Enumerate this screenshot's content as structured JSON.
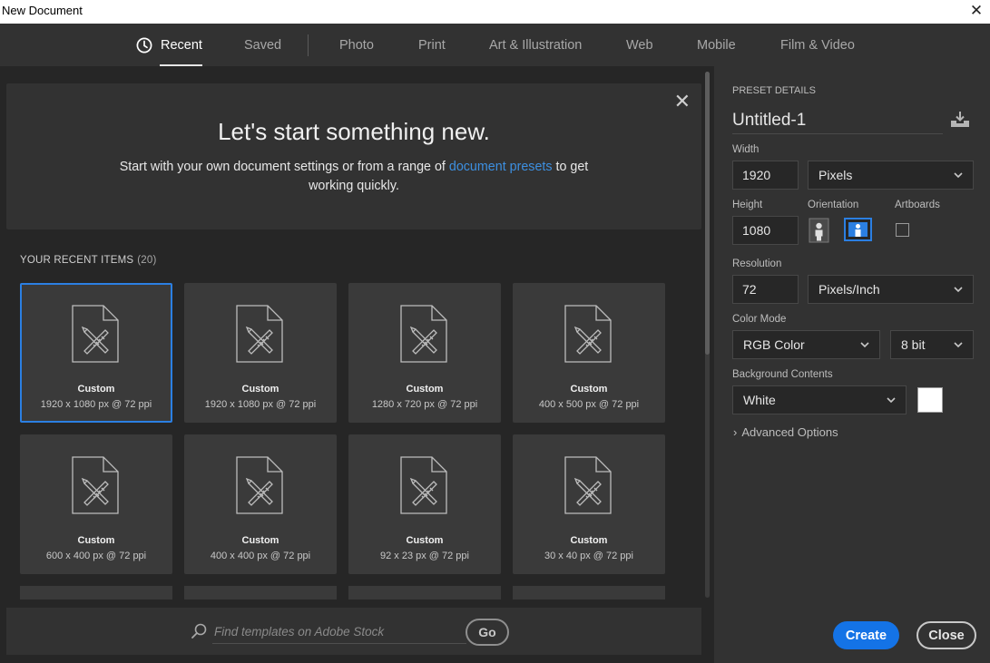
{
  "window": {
    "title": "New Document",
    "close_glyph": "✕"
  },
  "tabs": [
    {
      "label": "Recent",
      "active": true,
      "icon": "clock-icon"
    },
    {
      "label": "Saved"
    },
    {
      "label": "Photo"
    },
    {
      "label": "Print"
    },
    {
      "label": "Art & Illustration"
    },
    {
      "label": "Web"
    },
    {
      "label": "Mobile"
    },
    {
      "label": "Film & Video"
    }
  ],
  "hero": {
    "heading": "Let's start something new.",
    "text_before": "Start with your own document settings or from a range of ",
    "link": "document presets",
    "text_after": " to get working quickly.",
    "close_glyph": "✕"
  },
  "recent": {
    "label": "YOUR RECENT ITEMS",
    "count": "(20)",
    "items": [
      {
        "name": "Custom",
        "dims": "1920 x 1080 px @ 72 ppi",
        "selected": true
      },
      {
        "name": "Custom",
        "dims": "1920 x 1080 px @ 72 ppi"
      },
      {
        "name": "Custom",
        "dims": "1280 x 720 px @ 72 ppi"
      },
      {
        "name": "Custom",
        "dims": "400 x 500 px @ 72 ppi"
      },
      {
        "name": "Custom",
        "dims": "600 x 400 px @ 72 ppi"
      },
      {
        "name": "Custom",
        "dims": "400 x 400 px @ 72 ppi"
      },
      {
        "name": "Custom",
        "dims": "92 x 23 px @ 72 ppi"
      },
      {
        "name": "Custom",
        "dims": "30 x 40 px @ 72 ppi"
      }
    ]
  },
  "search": {
    "placeholder": "Find templates on Adobe Stock",
    "go_label": "Go",
    "icon": "search-icon"
  },
  "preset": {
    "section_label": "PRESET DETAILS",
    "doc_name": "Untitled-1",
    "width_label": "Width",
    "width_value": "1920",
    "width_unit": "Pixels",
    "height_label": "Height",
    "height_value": "1080",
    "orientation_label": "Orientation",
    "orientation_selected": "landscape",
    "artboards_label": "Artboards",
    "artboards_checked": false,
    "resolution_label": "Resolution",
    "resolution_value": "72",
    "resolution_unit": "Pixels/Inch",
    "color_mode_label": "Color Mode",
    "color_mode": "RGB Color",
    "bit_depth": "8 bit",
    "background_label": "Background Contents",
    "background": "White",
    "background_color": "#ffffff",
    "advanced_label": "Advanced Options",
    "advanced_arrow": "›"
  },
  "actions": {
    "create_label": "Create",
    "close_label": "Close"
  },
  "colors": {
    "accent": "#1473e6",
    "link": "#3d8fe0",
    "selected_border": "#2b7fe2"
  }
}
